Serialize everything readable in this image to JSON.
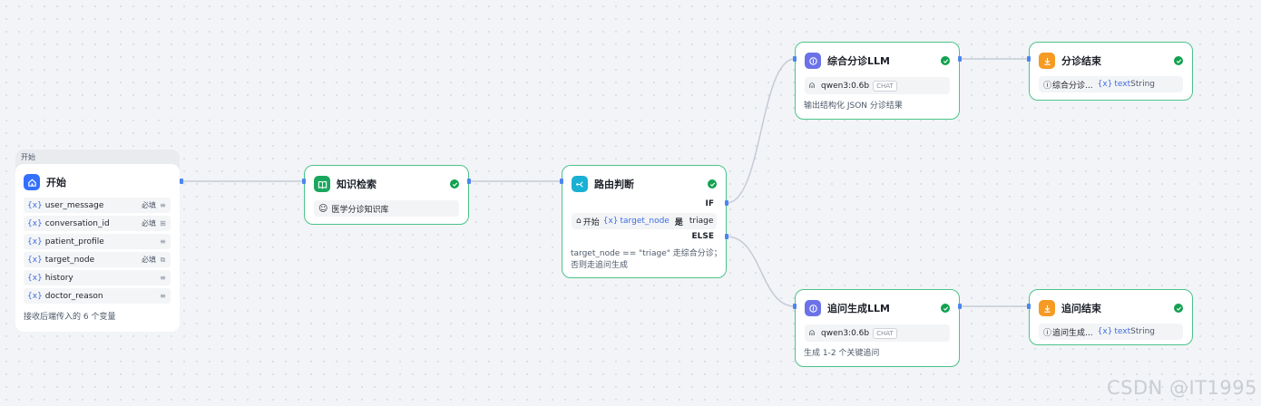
{
  "colors": {
    "success": "#12a150",
    "node_border": "#4cc38a",
    "edge": "#c5cbd6",
    "port": "#4d86f0",
    "var_blue": "#3e6de0",
    "start_icon": "#3370ff",
    "knowledge_icon": "#19a75d",
    "router_icon": "#1ab0d4",
    "llm_icon": "#6b72e8",
    "end_icon": "#f59a23"
  },
  "start": {
    "group_label": "开始",
    "title": "开始",
    "icon": "home-icon",
    "variables": [
      {
        "prefix": "{x}",
        "name": "user_message",
        "required": "必填",
        "icon": "text-lines-icon"
      },
      {
        "prefix": "{x}",
        "name": "conversation_id",
        "required": "必填",
        "icon": "number-box-icon"
      },
      {
        "prefix": "{x}",
        "name": "patient_profile",
        "required": "",
        "icon": "text-lines-icon"
      },
      {
        "prefix": "{x}",
        "name": "target_node",
        "required": "必填",
        "icon": "copy-box-icon"
      },
      {
        "prefix": "{x}",
        "name": "history",
        "required": "",
        "icon": "text-lines-icon"
      },
      {
        "prefix": "{x}",
        "name": "doctor_reason",
        "required": "",
        "icon": "text-lines-icon"
      }
    ],
    "footer": "接收后端传入的 6 个变量"
  },
  "knowledge": {
    "title": "知识检索",
    "icon": "book-icon",
    "kb_icon": "robot-face-icon",
    "kb_name": "医学分诊知识库"
  },
  "router": {
    "title": "路由判断",
    "icon": "branch-icon",
    "if_label": "IF",
    "cond_node_icon": "home-icon",
    "cond_node": "开始",
    "cond_var_prefix": "{x}",
    "cond_var": "target_node",
    "cond_op": "是",
    "cond_value": "triage",
    "else_label": "ELSE",
    "desc_line1": "target_node == \"triage\" 走综合分诊；",
    "desc_line2": "否则走追问生成"
  },
  "llm_triage": {
    "title": "综合分诊LLM",
    "icon": "llm-icon",
    "model_icon": "model-icon",
    "model": "qwen3:0.6b",
    "badge": "CHAT",
    "desc": "输出结构化 JSON 分诊结果"
  },
  "llm_followup": {
    "title": "追问生成LLM",
    "icon": "llm-icon",
    "model_icon": "model-icon",
    "model": "qwen3:0.6b",
    "badge": "CHAT",
    "desc": "生成 1-2 个关键追问"
  },
  "end_triage": {
    "title": "分诊结束",
    "icon": "end-icon",
    "src_icon": "info-icon",
    "src": "综合分诊...",
    "var_prefix": "{x}",
    "var": "text",
    "type": "String"
  },
  "end_followup": {
    "title": "追问结束",
    "icon": "end-icon",
    "src_icon": "info-icon",
    "src": "追问生成...",
    "var_prefix": "{x}",
    "var": "text",
    "type": "String"
  },
  "watermark": "CSDN @IT1995"
}
